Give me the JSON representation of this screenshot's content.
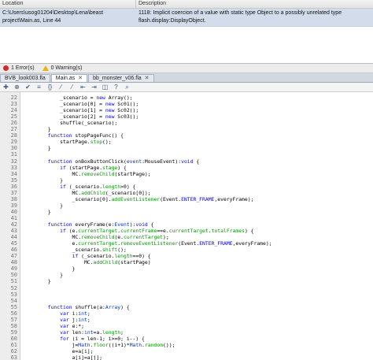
{
  "errors_panel": {
    "columns": {
      "location": "Location",
      "description": "Description"
    },
    "row": {
      "location": "C:\\Users\\usog01204\\Desktop\\Lena\\beast project\\Main.as, Line 44",
      "description": "1118: Implicit coercion of a value with static type Object to a possibly unrelated type flash.display:DisplayObject."
    }
  },
  "status_bar": {
    "errors": "1 Error(s)",
    "warnings": "0 Warning(s)"
  },
  "tabs": [
    {
      "label": "BVB_look003.fla",
      "active": false,
      "closable": false
    },
    {
      "label": "Main.as",
      "active": true,
      "closable": true
    },
    {
      "label": "bb_monster_v06.fla",
      "active": false,
      "closable": true
    }
  ],
  "toolbar": [
    "plus-icon",
    "target-icon",
    "check-icon",
    "lines-icon",
    "brackets-icon",
    "block-comment-icon",
    "line-comment-icon",
    "outdent-icon",
    "indent-icon",
    "code-snippet-icon",
    "help-icon",
    "search-icon"
  ],
  "editor": {
    "first_line": 22,
    "lines": [
      [
        [
          "            _scenario = ",
          ""
        ],
        [
          "new",
          "kw"
        ],
        [
          " Array();",
          ""
        ]
      ],
      [
        [
          "            _scenario[0] = ",
          ""
        ],
        [
          "new",
          "kw"
        ],
        [
          " Sc01();",
          ""
        ]
      ],
      [
        [
          "            _scenario[1] = ",
          ""
        ],
        [
          "new",
          "kw"
        ],
        [
          " Sc02();",
          ""
        ]
      ],
      [
        [
          "            _scenario[2] = ",
          ""
        ],
        [
          "new",
          "kw"
        ],
        [
          " Sc03();",
          ""
        ]
      ],
      [
        [
          "            shuffle(_scenario);",
          ""
        ]
      ],
      [
        [
          "        }",
          ""
        ]
      ],
      [
        [
          "        ",
          ""
        ],
        [
          "function",
          "kw"
        ],
        [
          " stopPageFunc() {",
          ""
        ]
      ],
      [
        [
          "            startPage.",
          ""
        ],
        [
          "stop",
          "fn"
        ],
        [
          "();",
          ""
        ]
      ],
      [
        [
          "        }",
          ""
        ]
      ],
      [
        [
          "",
          ""
        ]
      ],
      [
        [
          "        ",
          ""
        ],
        [
          "function",
          "kw"
        ],
        [
          " onBoxButtonClick(",
          ""
        ],
        [
          "event",
          "ty"
        ],
        [
          ":MouseEvent):",
          ""
        ],
        [
          "void",
          "kw"
        ],
        [
          " {",
          ""
        ]
      ],
      [
        [
          "            ",
          ""
        ],
        [
          "if",
          "kw"
        ],
        [
          " (startPage.",
          ""
        ],
        [
          "stage",
          "fn"
        ],
        [
          ") {",
          ""
        ]
      ],
      [
        [
          "                MC.",
          ""
        ],
        [
          "removeChild",
          "fn"
        ],
        [
          "(startPage);",
          ""
        ]
      ],
      [
        [
          "            }",
          ""
        ]
      ],
      [
        [
          "            ",
          ""
        ],
        [
          "if",
          "kw"
        ],
        [
          " (_scenario.",
          ""
        ],
        [
          "length",
          "fn"
        ],
        [
          ">0) {",
          ""
        ]
      ],
      [
        [
          "                MC.",
          ""
        ],
        [
          "addChild",
          "fn"
        ],
        [
          "(_scenario[0]);",
          ""
        ]
      ],
      [
        [
          "                _scenario[0].",
          ""
        ],
        [
          "addEventListener",
          "fn"
        ],
        [
          "(Event.",
          ""
        ],
        [
          "ENTER_FRAME",
          "cs"
        ],
        [
          ",everyFrame);",
          ""
        ]
      ],
      [
        [
          "            }",
          ""
        ]
      ],
      [
        [
          "        }",
          ""
        ]
      ],
      [
        [
          "",
          ""
        ]
      ],
      [
        [
          "        ",
          ""
        ],
        [
          "function",
          "kw"
        ],
        [
          " everyFrame(e:",
          ""
        ],
        [
          "Event",
          "ty"
        ],
        [
          "):",
          ""
        ],
        [
          "void",
          "kw"
        ],
        [
          " {",
          ""
        ]
      ],
      [
        [
          "            ",
          ""
        ],
        [
          "if",
          "kw"
        ],
        [
          " (e.",
          ""
        ],
        [
          "currentTarget",
          "fn"
        ],
        [
          ".",
          ""
        ],
        [
          "currentFrame",
          "fn"
        ],
        [
          "==e.",
          ""
        ],
        [
          "currentTarget",
          "fn"
        ],
        [
          ".",
          ""
        ],
        [
          "totalFrames",
          "fn"
        ],
        [
          ") {",
          ""
        ]
      ],
      [
        [
          "                MC.",
          ""
        ],
        [
          "removeChild",
          "fn"
        ],
        [
          "(e.",
          ""
        ],
        [
          "currentTarget",
          "fn"
        ],
        [
          ");",
          ""
        ]
      ],
      [
        [
          "                e.",
          ""
        ],
        [
          "currentTarget",
          "fn"
        ],
        [
          ".",
          ""
        ],
        [
          "removeEventListener",
          "fn"
        ],
        [
          "(Event.",
          ""
        ],
        [
          "ENTER_FRAME",
          "cs"
        ],
        [
          ",everyFrame);",
          ""
        ]
      ],
      [
        [
          "                _scenario.",
          ""
        ],
        [
          "shift",
          "fn"
        ],
        [
          "();",
          ""
        ]
      ],
      [
        [
          "                ",
          ""
        ],
        [
          "if",
          "kw"
        ],
        [
          " (_scenario.",
          ""
        ],
        [
          "length",
          "fn"
        ],
        [
          "==0) {",
          ""
        ]
      ],
      [
        [
          "                    MC.",
          ""
        ],
        [
          "addChild",
          "fn"
        ],
        [
          "(startPage)",
          ""
        ]
      ],
      [
        [
          "                }",
          ""
        ]
      ],
      [
        [
          "            }",
          ""
        ]
      ],
      [
        [
          "        }",
          ""
        ]
      ],
      [
        [
          "",
          ""
        ]
      ],
      [
        [
          "",
          ""
        ]
      ],
      [
        [
          "",
          ""
        ]
      ],
      [
        [
          "        ",
          ""
        ],
        [
          "function",
          "kw"
        ],
        [
          " shuffle(a:",
          ""
        ],
        [
          "Array",
          "ty"
        ],
        [
          ") {",
          ""
        ]
      ],
      [
        [
          "            ",
          ""
        ],
        [
          "var",
          "kw"
        ],
        [
          " i:",
          ""
        ],
        [
          "int",
          "ty"
        ],
        [
          ";",
          ""
        ]
      ],
      [
        [
          "            ",
          ""
        ],
        [
          "var",
          "kw"
        ],
        [
          " j:",
          ""
        ],
        [
          "int",
          "ty"
        ],
        [
          ";",
          ""
        ]
      ],
      [
        [
          "            ",
          ""
        ],
        [
          "var",
          "kw"
        ],
        [
          " e:*;",
          ""
        ]
      ],
      [
        [
          "            ",
          ""
        ],
        [
          "var",
          "kw"
        ],
        [
          " len:",
          ""
        ],
        [
          "int",
          "ty"
        ],
        [
          "=a.",
          ""
        ],
        [
          "length",
          "fn"
        ],
        [
          ";",
          ""
        ]
      ],
      [
        [
          "            ",
          ""
        ],
        [
          "for",
          "kw"
        ],
        [
          " (i = len-1; i>=0; i--) {",
          ""
        ]
      ],
      [
        [
          "                j=",
          ""
        ],
        [
          "Math",
          "ty"
        ],
        [
          ".",
          ""
        ],
        [
          "floor",
          "fn"
        ],
        [
          "((i+1)*",
          ""
        ],
        [
          "Math",
          "ty"
        ],
        [
          ".",
          ""
        ],
        [
          "random",
          "fn"
        ],
        [
          "());",
          ""
        ]
      ],
      [
        [
          "                e=a[i];",
          ""
        ]
      ],
      [
        [
          "                a[i]=a[j];",
          ""
        ]
      ]
    ]
  }
}
